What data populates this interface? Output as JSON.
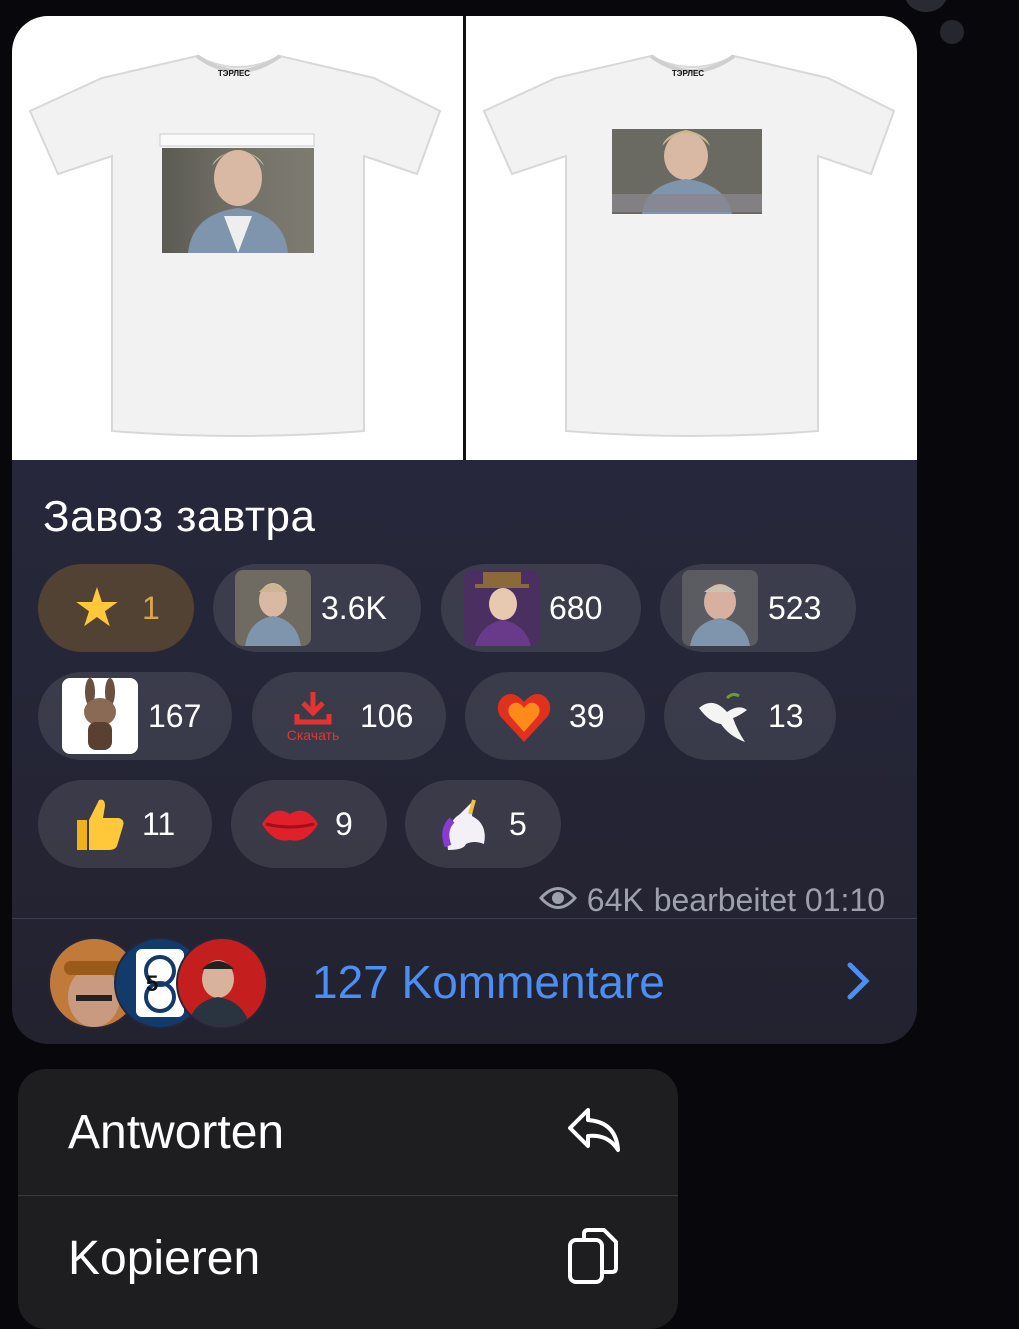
{
  "message": {
    "caption": "Завоз завтра",
    "tshirt_brand": "ТЭРЛЕС",
    "reactions": [
      {
        "emoji": "star-icon",
        "count": "1"
      },
      {
        "emoji": "face-sticker-1",
        "count": "3.6K"
      },
      {
        "emoji": "face-sticker-wonka",
        "count": "680"
      },
      {
        "emoji": "face-sticker-3",
        "count": "523"
      },
      {
        "emoji": "bunny-sticker",
        "count": "167"
      },
      {
        "emoji": "download-sticker",
        "count": "106",
        "sticker_text": "Скачать"
      },
      {
        "emoji": "heart-on-fire",
        "count": "39"
      },
      {
        "emoji": "dove",
        "count": "13"
      },
      {
        "emoji": "thumbs-up",
        "count": "11"
      },
      {
        "emoji": "kiss-mark",
        "count": "9"
      },
      {
        "emoji": "unicorn",
        "count": "5"
      }
    ],
    "views": "64K",
    "edited_time": "bearbeitet 01:10",
    "comments_label": "127 Kommentare",
    "comment_avatar_badge": "5"
  },
  "context_menu": {
    "items": [
      {
        "label": "Antworten",
        "icon": "reply-icon"
      },
      {
        "label": "Kopieren",
        "icon": "copy-icon"
      }
    ]
  },
  "colors": {
    "accent": "#4b8ef4",
    "bubble": "#262739",
    "menu": "#1e1e20"
  }
}
